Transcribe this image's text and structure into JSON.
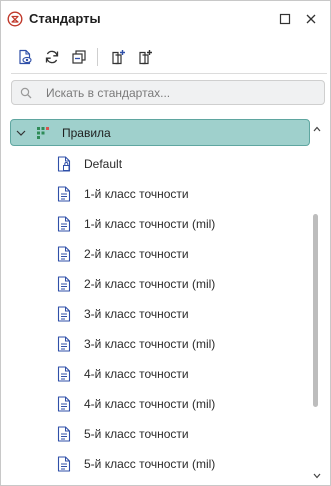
{
  "window": {
    "title": "Стандарты",
    "title_icon": "standards-logo-icon",
    "accent_color": "#c0392b",
    "maximize_icon": "maximize-icon",
    "close_icon": "close-icon"
  },
  "toolbar": {
    "buttons": [
      {
        "icon": "preview-document-icon"
      },
      {
        "icon": "refresh-icon"
      },
      {
        "icon": "collapse-all-icon"
      },
      {
        "icon": "add-item-icon"
      },
      {
        "icon": "add-sub-item-icon"
      }
    ]
  },
  "search": {
    "placeholder": "Искать в стандартах...",
    "value": ""
  },
  "tree": {
    "root": {
      "label": "Правила",
      "expanded": true,
      "selected": true,
      "selection_color": "#9fd0cc"
    },
    "items": [
      {
        "label": "Default",
        "icon": "default-rules-icon"
      },
      {
        "label": "1-й класс точности",
        "icon": "document-icon"
      },
      {
        "label": "1-й класс точности (mil)",
        "icon": "document-icon"
      },
      {
        "label": "2-й класс точности",
        "icon": "document-icon"
      },
      {
        "label": "2-й класс точности (mil)",
        "icon": "document-icon"
      },
      {
        "label": "3-й класс точности",
        "icon": "document-icon"
      },
      {
        "label": "3-й класс точности (mil)",
        "icon": "document-icon"
      },
      {
        "label": "4-й класс точности",
        "icon": "document-icon"
      },
      {
        "label": "4-й класс точности (mil)",
        "icon": "document-icon"
      },
      {
        "label": "5-й класс точности",
        "icon": "document-icon"
      },
      {
        "label": "5-й класс точности (mil)",
        "icon": "document-icon"
      }
    ]
  }
}
